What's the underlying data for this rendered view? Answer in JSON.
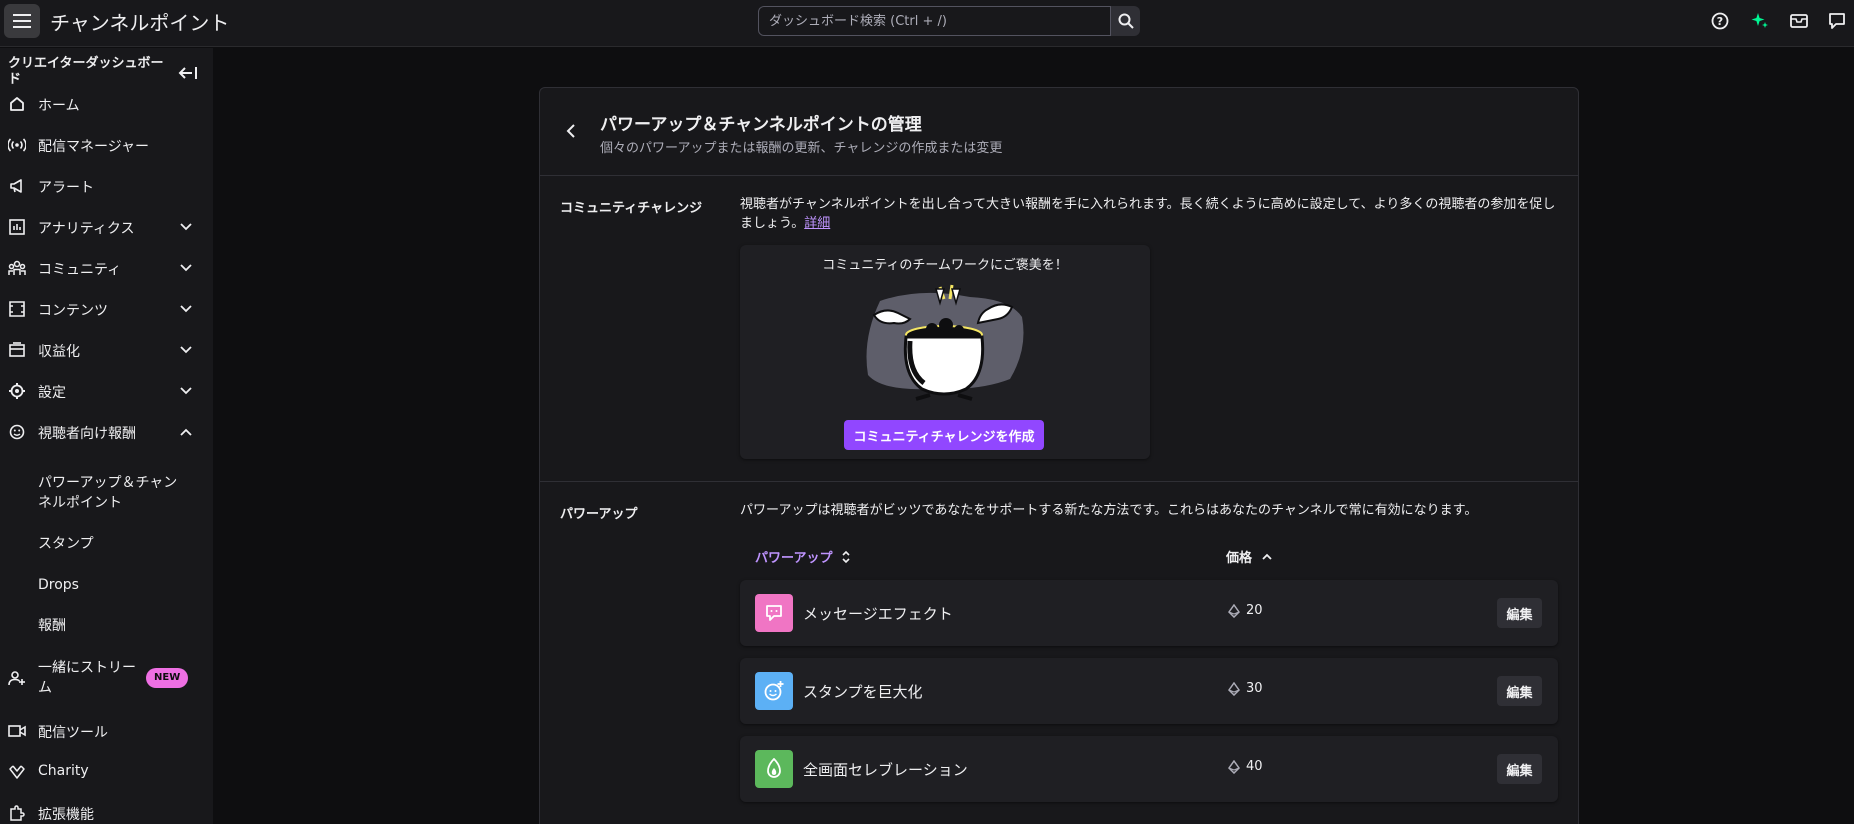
{
  "topbar": {
    "menu_icon": "hamburger-icon",
    "title": "チャンネルポイント",
    "search_placeholder": "ダッシュボード検索 (Ctrl + /)",
    "icons": [
      "help-icon",
      "sparkle-icon",
      "inbox-icon",
      "whispers-icon"
    ],
    "accent": "#00f593"
  },
  "sidebar": {
    "header": "クリエイターダッシュボード",
    "items": [
      {
        "label": "ホーム",
        "icon": "home-icon"
      },
      {
        "label": "配信マネージャー",
        "icon": "broadcast-icon"
      },
      {
        "label": "アラート",
        "icon": "megaphone-icon"
      },
      {
        "label": "アナリティクス",
        "icon": "analytics-icon"
      },
      {
        "label": "コミュニティ",
        "icon": "community-icon"
      },
      {
        "label": "コンテンツ",
        "icon": "content-icon"
      },
      {
        "label": "収益化",
        "icon": "monetization-icon"
      },
      {
        "label": "設定",
        "icon": "settings-icon"
      },
      {
        "label": "視聴者向け報酬",
        "icon": "rewards-icon"
      }
    ],
    "sub_items": [
      {
        "label": "パワーアップ＆チャンネルポイント"
      },
      {
        "label": "スタンプ"
      },
      {
        "label": "Drops"
      },
      {
        "label": "報酬"
      }
    ],
    "bottom_items": [
      {
        "label": "一緒にストリーム",
        "icon": "stream-together-icon",
        "badge": "NEW"
      },
      {
        "label": "配信ツール",
        "icon": "camera-icon"
      },
      {
        "label": "Charity",
        "icon": "charity-icon"
      },
      {
        "label": "拡張機能",
        "icon": "extensions-icon"
      }
    ],
    "badge_color": "#ee6fe3"
  },
  "panel": {
    "title": "パワーアップ＆チャンネルポイントの管理",
    "subtitle": "個々のパワーアップまたは報酬の更新、チャレンジの作成または変更"
  },
  "community_challenge": {
    "label": "コミュニティチャレンジ",
    "description": "視聴者がチャンネルポイントを出し合って大きい報酬を手に入れられます。長く続くように高めに設定して、より多くの視聴者の参加を促しましょう。",
    "link_text": "詳細",
    "card_title": "コミュニティのチームワークにご褒美を！",
    "create_button": "コミュニティチャレンジを作成",
    "accent": "#9147ff"
  },
  "powerups": {
    "label": "パワーアップ",
    "description": "パワーアップは視聴者がビッツであなたをサポートする新たな方法です。これらはあなたのチャンネルで常に有効になります。",
    "columns": {
      "name": "パワーアップ",
      "price": "価格"
    },
    "rows": [
      {
        "name": "メッセージエフェクト",
        "price": "20",
        "icon": "message-effect-icon",
        "color": "#f075c4",
        "edit": "編集"
      },
      {
        "name": "スタンプを巨大化",
        "price": "30",
        "icon": "giant-emote-icon",
        "color": "#5cb0f5",
        "edit": "編集"
      },
      {
        "name": "全画面セレブレーション",
        "price": "40",
        "icon": "celebration-icon",
        "color": "#5cb85c",
        "edit": "編集"
      }
    ]
  }
}
